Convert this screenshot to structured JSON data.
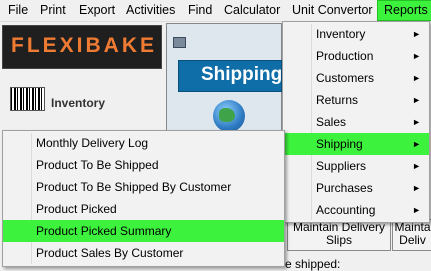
{
  "menubar": {
    "items": [
      "File",
      "Print",
      "Export",
      "Activities",
      "Find",
      "Calculator",
      "Unit Convertor",
      "Reports"
    ],
    "active": "Reports",
    "highlight_color": "#3df23d"
  },
  "app": {
    "logo_text": "FLEXIBAKE",
    "inventory_label": "Inventory",
    "shipping_banner": "Shipping",
    "maintain_delivery_label": "Maintain Delivery\nSlips",
    "maintain_partial_label": "Mainta\nDeliv",
    "shipped_text": "e shipped:"
  },
  "reports_menu": {
    "items": [
      {
        "label": "Inventory",
        "submenu": true
      },
      {
        "label": "Production",
        "submenu": true
      },
      {
        "label": "Customers",
        "submenu": true
      },
      {
        "label": "Returns",
        "submenu": true
      },
      {
        "label": "Sales",
        "submenu": true
      },
      {
        "label": "Shipping",
        "submenu": true,
        "highlighted": true
      },
      {
        "label": "Suppliers",
        "submenu": true
      },
      {
        "label": "Purchases",
        "submenu": true
      },
      {
        "label": "Accounting",
        "submenu": true
      }
    ],
    "arrow_glyph": "►"
  },
  "shipping_submenu": {
    "items": [
      {
        "label": "Monthly Delivery Log"
      },
      {
        "label": "Product To Be Shipped"
      },
      {
        "label": "Product To Be Shipped By Customer"
      },
      {
        "label": "Product Picked"
      },
      {
        "label": "Product Picked Summary",
        "highlighted": true
      },
      {
        "label": "Product Sales By Customer"
      }
    ]
  }
}
